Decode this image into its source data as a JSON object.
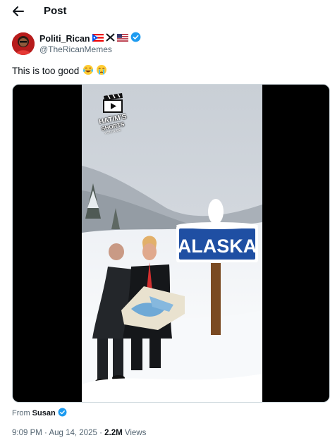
{
  "header": {
    "title": "Post",
    "back_icon": "arrow-left-icon"
  },
  "author": {
    "display_name": "Politi_Rican",
    "handle": "@TheRicanMemes",
    "badges": [
      "puerto-rico-flag-icon",
      "x-logo-icon",
      "us-flag-icon",
      "verified-badge-icon"
    ]
  },
  "post": {
    "text": "This is too good",
    "emojis": [
      "laughing-tears-emoji",
      "crying-emoji"
    ]
  },
  "media": {
    "watermark_line1": "HATIM'S",
    "watermark_line2": "SHORTS",
    "watermark_line3": "YOUTUBE",
    "sign_text": "ALASKA"
  },
  "source": {
    "prefix": "From",
    "name": "Susan"
  },
  "meta": {
    "time": "9:09 PM",
    "separator": "·",
    "date": "Aug 14, 2025",
    "views_count": "2.2M",
    "views_label": "Views"
  },
  "colors": {
    "verified": "#1d9bf0",
    "muted": "#536471",
    "sign_blue": "#1f4fa3"
  }
}
